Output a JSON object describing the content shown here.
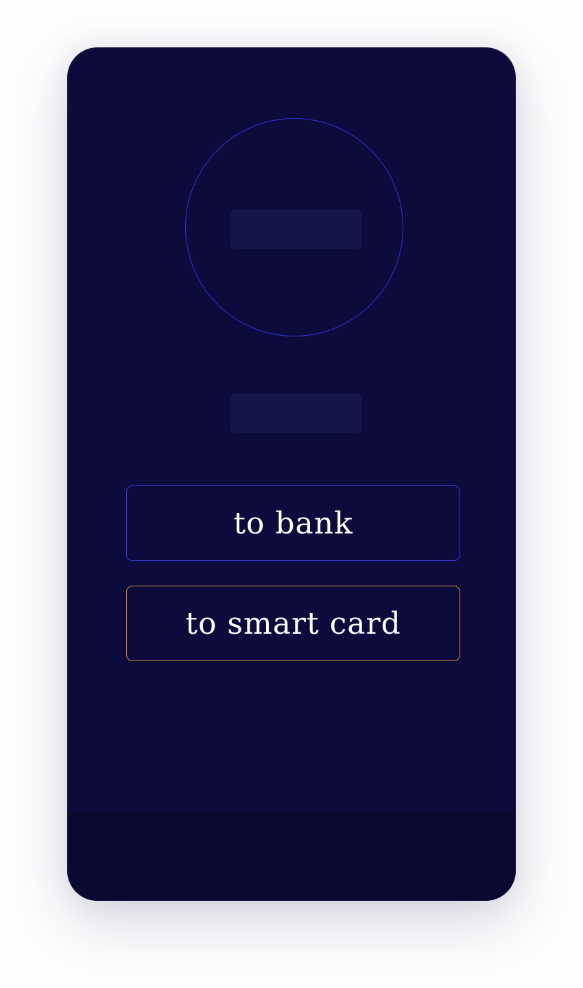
{
  "actions": {
    "to_bank_label": "to bank",
    "to_smart_card_label": "to smart card"
  },
  "colors": {
    "background": "#0c0b3c",
    "footer": "#0a0932",
    "placeholder": "#15154a",
    "accent_blue": "#3a3ae0",
    "accent_orange": "#d98a34",
    "text": "#ffffff"
  }
}
